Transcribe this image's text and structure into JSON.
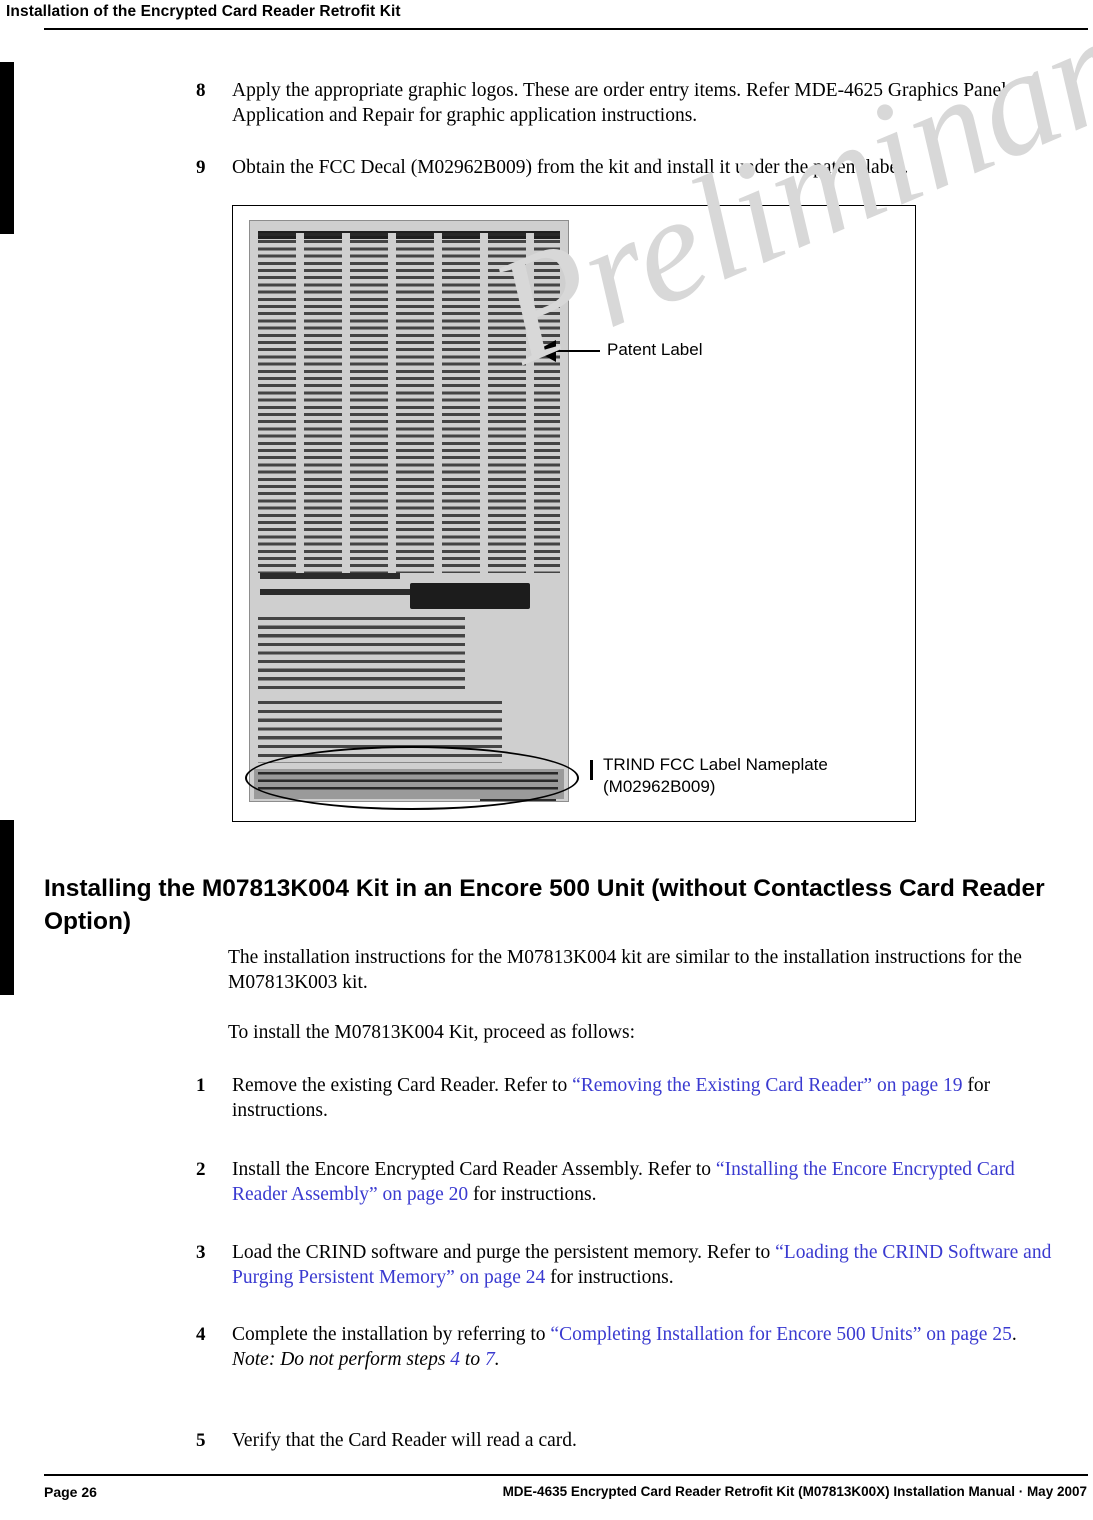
{
  "header": {
    "title": "Installation of the Encrypted Card Reader Retrofit Kit"
  },
  "footer": {
    "page": "Page 26",
    "doc": "MDE-4635 Encrypted Card Reader Retrofit Kit (M07813K00X) Installation Manual · May 2007"
  },
  "watermark": {
    "text": "Preliminary"
  },
  "steps_top": [
    {
      "num": "8",
      "text": "Apply the appropriate graphic logos. These are order entry items. Refer MDE-4625 Graphics Panel Application and Repair for graphic application instructions."
    },
    {
      "num": "9",
      "text": "Obtain the FCC Decal (M02962B009) from the kit and install it under the patent label."
    }
  ],
  "figure": {
    "callout_patent": "Patent Label",
    "callout_nameplate_line1": "TRIND FCC Label Nameplate",
    "callout_nameplate_line2": "(M02962B009)"
  },
  "section": {
    "heading": "Installing the M07813K004 Kit in an Encore 500 Unit (without Contactless Card Reader Option)",
    "para1": "The installation instructions for the M07813K004 kit are similar to the installation instructions for the M07813K003 kit.",
    "para2": "To install the M07813K004 Kit, proceed as follows:"
  },
  "steps_bottom": [
    {
      "num": "1",
      "pre": "Remove the existing Card Reader. Refer to ",
      "link": "“Removing the Existing Card Reader” on page 19",
      "post": " for instructions."
    },
    {
      "num": "2",
      "pre": "Install the Encore Encrypted Card Reader Assembly. Refer to ",
      "link": "“Installing the Encore Encrypted Card Reader Assembly” on page 20",
      "post": " for instructions."
    },
    {
      "num": "3",
      "pre": "Load the CRIND software and purge the persistent memory. Refer to ",
      "link": "“Loading the CRIND Software and Purging Persistent Memory” on page 24",
      "post": " for instructions."
    },
    {
      "num": "4",
      "pre": "Complete the installation by referring to ",
      "link": "“Completing Installation for Encore 500 Units” on page 25",
      "post": ".",
      "note_label": "Note:",
      "note_pre": " Do not perform steps ",
      "note_link1": "4",
      "note_mid": " to ",
      "note_link2": "7",
      "note_post": "."
    },
    {
      "num": "5",
      "pre": "Verify that the Card Reader will read a card.",
      "link": "",
      "post": ""
    }
  ],
  "colors": {
    "link": "#3a3ad0",
    "text": "#000000",
    "watermark": "#d8d8d8"
  }
}
